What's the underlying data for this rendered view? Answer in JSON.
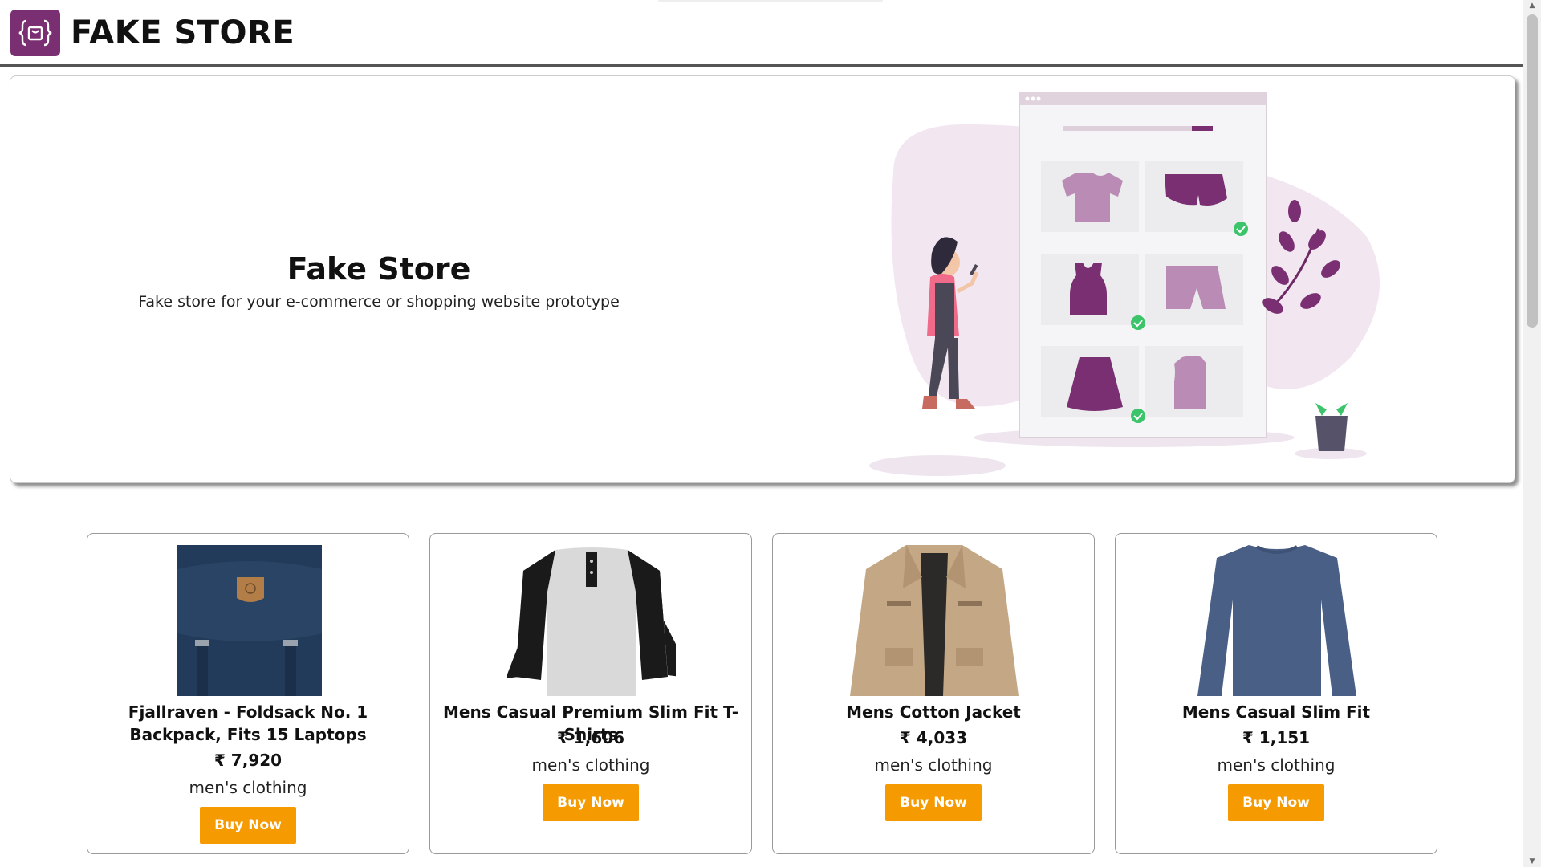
{
  "header": {
    "brand": "FAKE STORE",
    "logo_icon": "shopping-bag-icon",
    "accent": "#7b2f73"
  },
  "hero": {
    "title": "Fake Store",
    "subtitle": "Fake store for your e-commerce or shopping website prototype",
    "illustration_icon": "online-shopping-illustration"
  },
  "products": [
    {
      "title": "Fjallraven - Foldsack No. 1 Backpack, Fits 15 Laptops",
      "price": "₹ 7,920",
      "category": "men's clothing",
      "button": "Buy Now",
      "image_icon": "backpack-image"
    },
    {
      "title": "Mens Casual Premium Slim Fit T-Shirts",
      "price": "₹ 1,606",
      "category": "men's clothing",
      "button": "Buy Now",
      "image_icon": "raglan-tshirt-image"
    },
    {
      "title": "Mens Cotton Jacket",
      "price": "₹ 4,033",
      "category": "men's clothing",
      "button": "Buy Now",
      "image_icon": "cotton-jacket-image"
    },
    {
      "title": "Mens Casual Slim Fit",
      "price": "₹ 1,151",
      "category": "men's clothing",
      "button": "Buy Now",
      "image_icon": "longsleeve-shirt-image"
    }
  ],
  "colors": {
    "button": "#f59a00",
    "accent_purple": "#7b2f73",
    "light_purple": "#b98bb5",
    "check_green": "#3cc46b"
  }
}
